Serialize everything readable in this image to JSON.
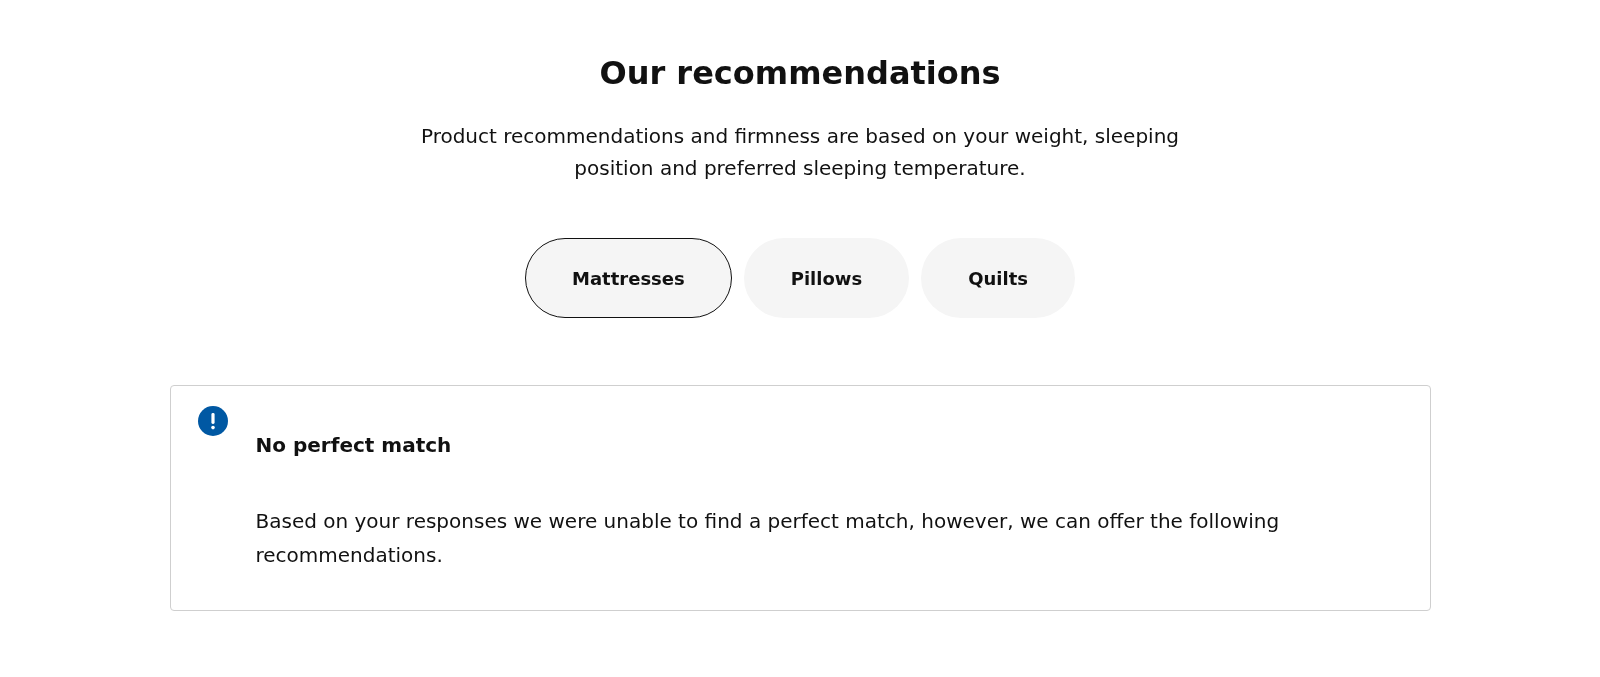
{
  "heading": "Our recommendations",
  "intro": "Product recommendations and firmness are based on your weight, sleeping position and preferred sleeping temperature.",
  "tabs": [
    {
      "label": "Mattresses",
      "selected": true
    },
    {
      "label": "Pillows",
      "selected": false
    },
    {
      "label": "Quilts",
      "selected": false
    }
  ],
  "alert": {
    "title": "No perfect match",
    "message": "Based on your responses we were unable to find a perfect match, however, we can offer the following recommendations."
  }
}
